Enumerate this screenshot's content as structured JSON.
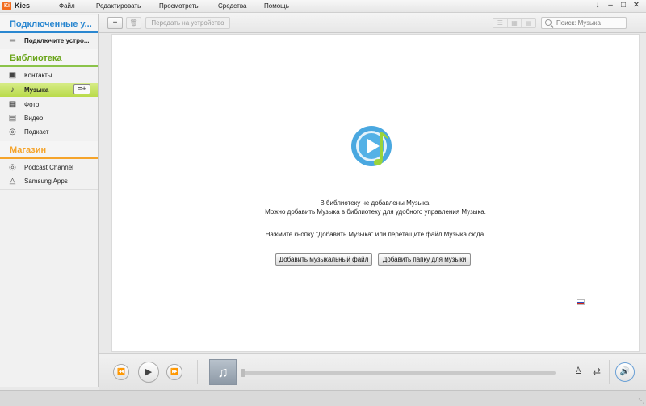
{
  "app": {
    "title": "Kies",
    "logo": "Ki"
  },
  "menu": [
    "Файл",
    "Редактировать",
    "Просмотреть",
    "Средства",
    "Помощь"
  ],
  "window_controls": [
    "↓",
    "–",
    "□",
    "✕"
  ],
  "toolbar": {
    "add_label": "+",
    "delete_label": "🗑",
    "transfer_label": "Передать на устройство",
    "view_icons": [
      "☰",
      "▦",
      "▤"
    ],
    "search_placeholder": "Поиск: Музыка"
  },
  "sidebar": {
    "connected_header": "Подключенные у...",
    "connect_device": "Подключите устро...",
    "library_header": "Библиотека",
    "library_items": [
      {
        "label": "Контакты",
        "icon": "contacts-icon"
      },
      {
        "label": "Музыка",
        "icon": "music-note-icon",
        "selected": true
      },
      {
        "label": "Фото",
        "icon": "photo-icon"
      },
      {
        "label": "Видео",
        "icon": "video-icon"
      },
      {
        "label": "Подкаст",
        "icon": "podcast-icon"
      }
    ],
    "add_playlist_label": "≡+",
    "store_header": "Магазин",
    "store_items": [
      {
        "label": "Podcast Channel",
        "icon": "podcast-icon"
      },
      {
        "label": "Samsung Apps",
        "icon": "samsung-apps-icon"
      }
    ]
  },
  "main": {
    "empty_line1": "В библиотеку не добавлены Музыка.",
    "empty_line2": "Можно добавить Музыка в библиотеку для удобного управления Музыка.",
    "empty_line3": "Нажмите кнопку \"Добавить Музыка\" или перетащите файл Музыка сюда.",
    "add_file_button": "Добавить музыкальный файл",
    "add_folder_button": "Добавить папку для музыки"
  },
  "player": {
    "prev": "⏪",
    "play": "▶",
    "next": "⏩",
    "album_art_icon": "♫",
    "progress": 0,
    "text_icon": "A",
    "shuffle": "⇄",
    "volume": "🔊"
  },
  "colors": {
    "accent_blue": "#2a87d0",
    "library_green": "#6aa51a",
    "store_orange": "#f5a42b",
    "selected_bg": "#c6e36a"
  }
}
